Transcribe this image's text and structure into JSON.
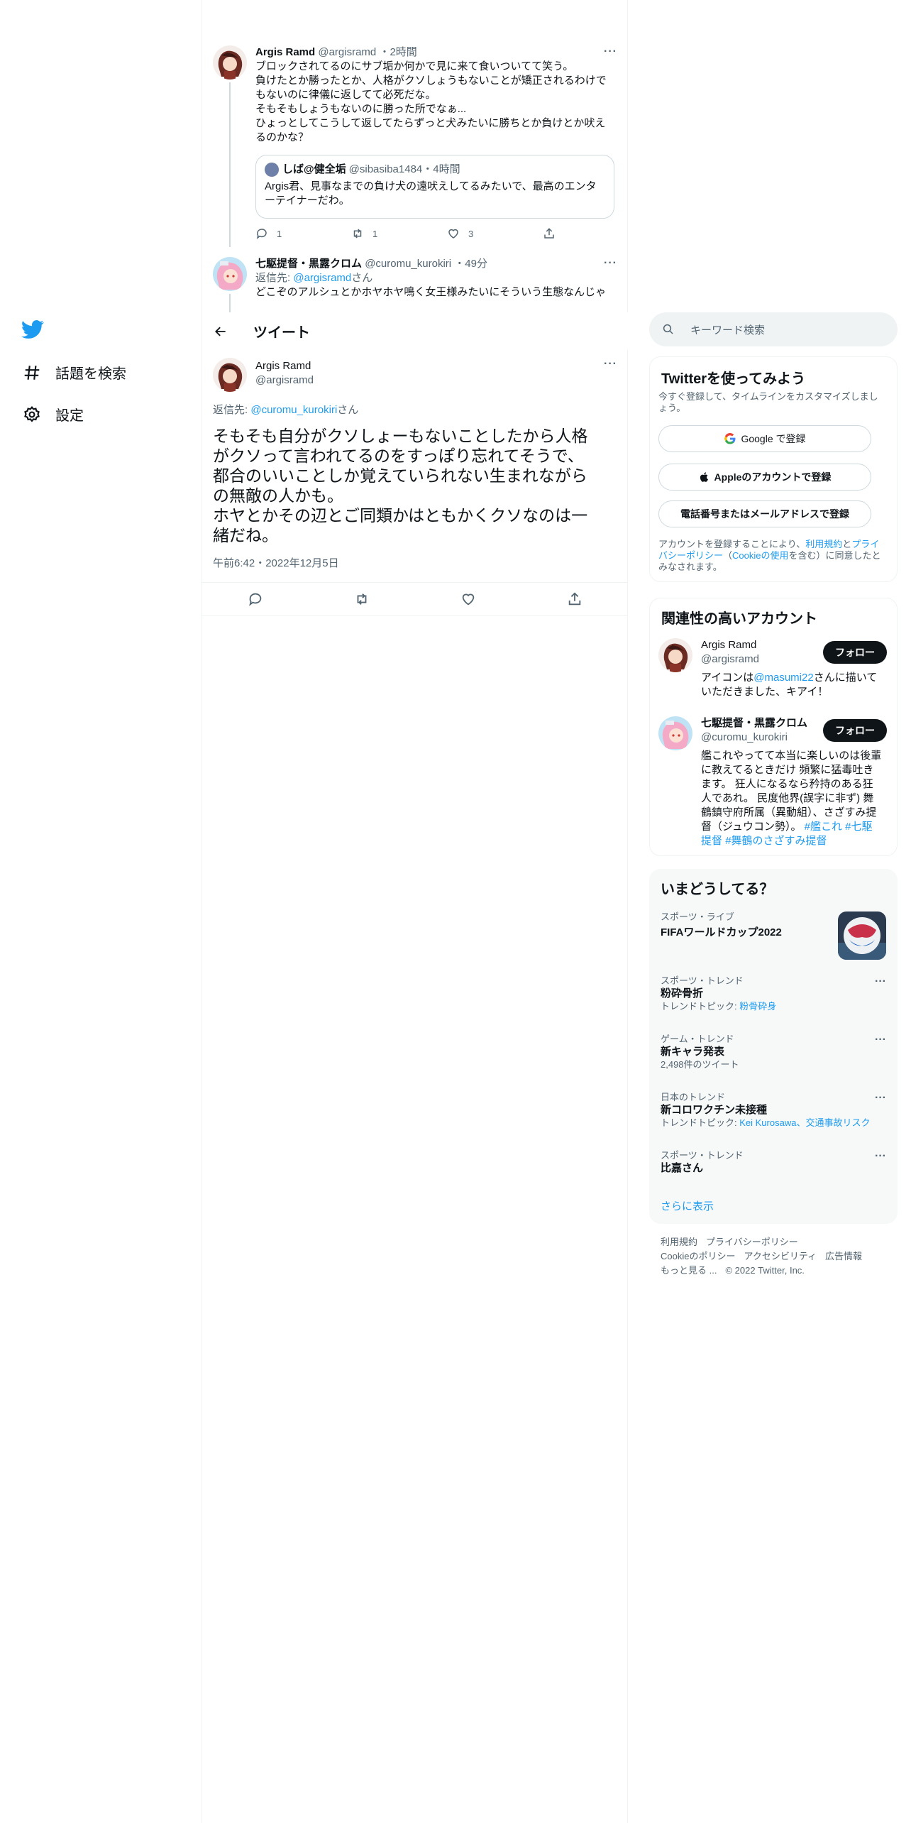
{
  "nav": {
    "explore_label": "話題を検索",
    "settings_label": "設定"
  },
  "thread": [
    {
      "name": "Argis Ramd",
      "handle": "@argisramd",
      "time": "・2時間",
      "lines": [
        "ブロックされてるのにサブ垢か何かで見に来て食いついてて笑う。",
        "負けたとか勝ったとか、人格がクソしょうもないことが矯正されるわけで",
        "もないのに律儀に返してて必死だな。",
        "そもそもしょうもないのに勝った所でなぁ...",
        "ひょっとしてこうして返してたらずっと犬みたいに勝ちとか負けとか吠え",
        "るのかな？"
      ],
      "quote": {
        "name": "しば@健全垢",
        "handle": "@sibasiba1484",
        "time": "・4時間",
        "lines": [
          "Argis君、見事なまでの負け犬の遠吠えしてるみたいで、最高のエンタ",
          "ーテイナーだわ。"
        ]
      },
      "reply_count": "1",
      "retweet_count": "1",
      "like_count": "3"
    },
    {
      "name": "七駆提督・黒露クロム",
      "handle": "@curomu_kurokiri",
      "time": "・49分",
      "reply_prefix": "返信先: ",
      "reply_to": "@argisramd",
      "reply_suffix": "さん",
      "line": "どこぞのアルシュとかホヤホヤ鳴く女王様みたいにそういう生態なんじゃ"
    }
  ],
  "header": {
    "title": "ツイート"
  },
  "main_tweet": {
    "name": "Argis Ramd",
    "handle": "@argisramd",
    "reply_prefix": "返信先: ",
    "reply_to": "@curomu_kurokiri",
    "reply_suffix": "さん",
    "lines": [
      "そもそも自分がクソしょーもないことしたから人格",
      "がクソって言われてるのをすっぽり忘れてそうで、",
      "都合のいいことしか覚えていられない生まれながら",
      "の無敵の人かも。",
      "ホヤとかその辺とご同類かはともかくクソなのは一",
      "緒だね。"
    ],
    "timestamp": "午前6:42・2022年12月5日"
  },
  "search": {
    "placeholder": "キーワード検索"
  },
  "signup": {
    "title": "Twitterを使ってみよう",
    "subtitle": "今すぐ登録して、タイムラインをカスタマイズしましょう。",
    "google_label": "Google で登録",
    "apple_label": "Appleのアカウントで登録",
    "phone_label": "電話番号またはメールアドレスで登録",
    "terms_pre": "アカウントを登録することにより、",
    "terms_link": "利用規約",
    "terms_mid": "と",
    "privacy_link": "プライバシーポリシー",
    "cookie_pre": "（",
    "cookie_link": "Cookieの使用",
    "terms_post": "を含む）に同意したとみなされます。"
  },
  "related": {
    "title": "関連性の高いアカウント",
    "follow_label": "フォロー",
    "accounts": [
      {
        "name": "Argis Ramd",
        "handle": "@argisramd",
        "bio_pre": "アイコンは",
        "bio_link": "@masumi22",
        "bio_post": "さんに描いていただきました、キアイ！"
      },
      {
        "name": "七駆提督・黒露クロム",
        "handle": "@curomu_kurokiri",
        "bio_lines": [
          "艦これやってて本当に楽しいのは後輩",
          "に教えてるときだけ 頻繁に猛毒吐き",
          "ます。 狂人になるなら矜持のある狂",
          "人であれ。 民度他界(誤字に非ず) 舞",
          "鶴鎮守府所属（異動組）、さざすみ提"
        ],
        "bio_last": "督（ジュウコン勢）。",
        "tag1": "#艦これ",
        "tag2": "#七駆",
        "tag2b": "提督",
        "tag3": "#舞鶴のさざすみ提督"
      }
    ]
  },
  "trends": {
    "title": "いまどうしてる？",
    "items": [
      {
        "meta": "スポーツ・ライブ",
        "name": "FIFAワールドカップ2022"
      },
      {
        "meta": "スポーツ・トレンド",
        "name": "粉砕骨折",
        "sub_pre": "トレンドトピック: ",
        "sub_link": "粉骨砕身"
      },
      {
        "meta": "ゲーム・トレンド",
        "name": "新キャラ発表",
        "sub": "2,498件のツイート"
      },
      {
        "meta": "日本のトレンド",
        "name": "新コロワクチン未接種",
        "sub_pre": "トレンドトピック: ",
        "sub_link": "Kei Kurosawa、交通事故リスク"
      },
      {
        "meta": "スポーツ・トレンド",
        "name": "比嘉さん"
      }
    ],
    "show_more": "さらに表示"
  },
  "footer": {
    "terms": "利用規約",
    "privacy": "プライバシーポリシー",
    "cookie": "Cookieのポリシー",
    "accessibility": "アクセシビリティ",
    "ads": "広告情報",
    "more": "もっと見る ...",
    "copyright": "© 2022 Twitter, Inc."
  },
  "colors": {
    "accent": "#1d9bf0",
    "text": "#0f1419",
    "muted": "#536471",
    "border": "#eff3f4"
  }
}
